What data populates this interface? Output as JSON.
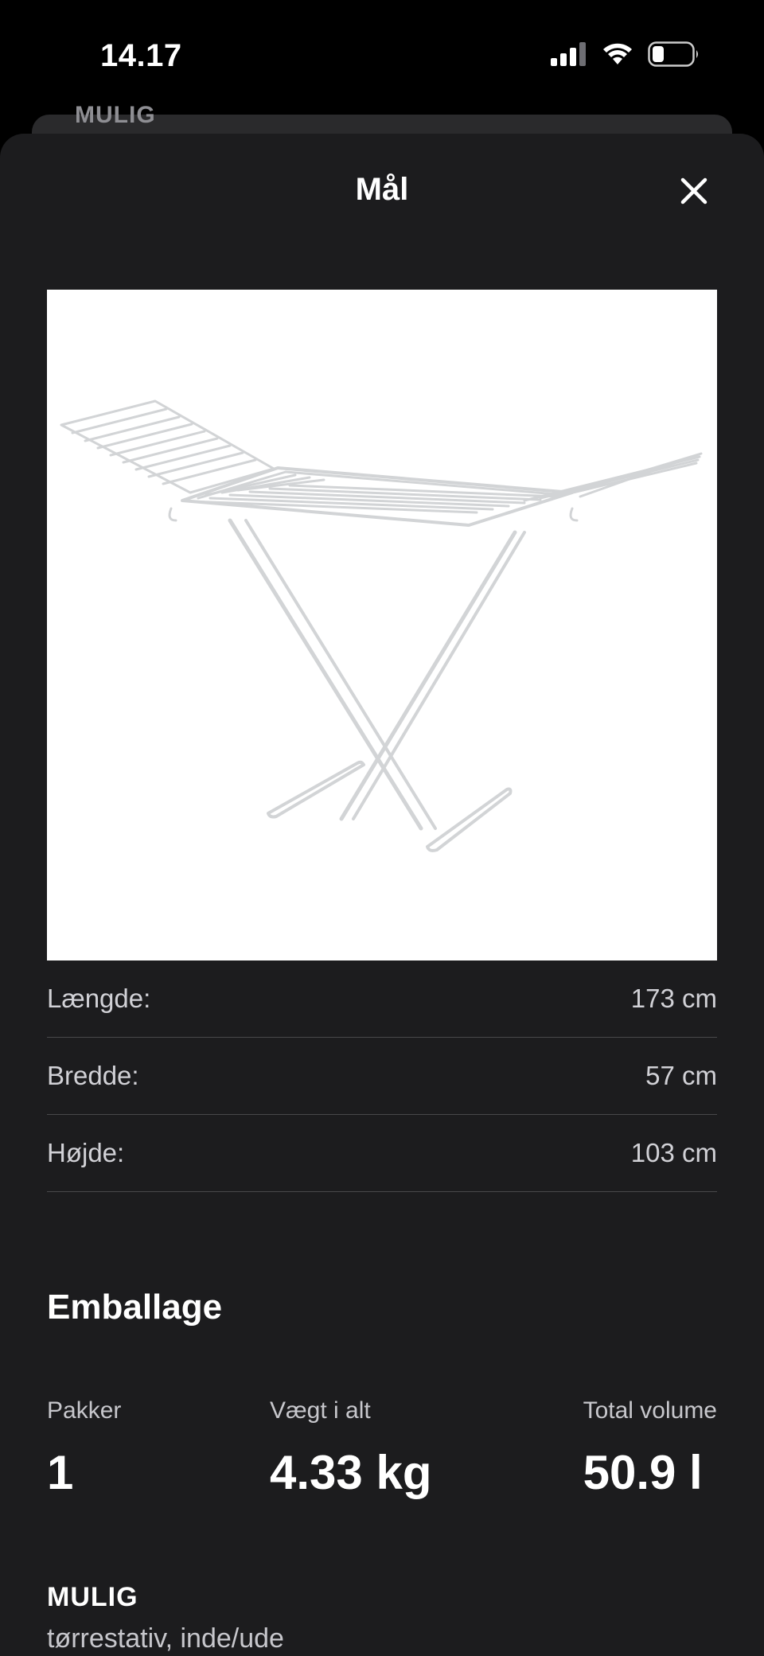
{
  "status_bar": {
    "time": "14.17",
    "icons": [
      "cellular-signal-icon",
      "wifi-icon",
      "battery-icon"
    ]
  },
  "behind": {
    "label": "MULIG"
  },
  "sheet": {
    "title": "Mål",
    "close_icon": "close-icon"
  },
  "product_image": {
    "icon": "drying-rack-illustration"
  },
  "dimensions": [
    {
      "label": "Længde:",
      "value": "173 cm"
    },
    {
      "label": "Bredde:",
      "value": "57 cm"
    },
    {
      "label": "Højde:",
      "value": "103 cm"
    }
  ],
  "packaging": {
    "heading": "Emballage",
    "packages_label": "Pakker",
    "packages_value": "1",
    "weight_label": "Vægt i alt",
    "weight_value": "4.33 kg",
    "volume_label": "Total volume",
    "volume_value": "50.9 l"
  },
  "product": {
    "name": "MULIG",
    "description": "tørrestativ, inde/ude"
  },
  "colors": {
    "background": "#000000",
    "sheet": "#1c1c1e",
    "divider": "#48484a",
    "text_primary": "#ffffff",
    "text_secondary": "#c7c7cc"
  }
}
